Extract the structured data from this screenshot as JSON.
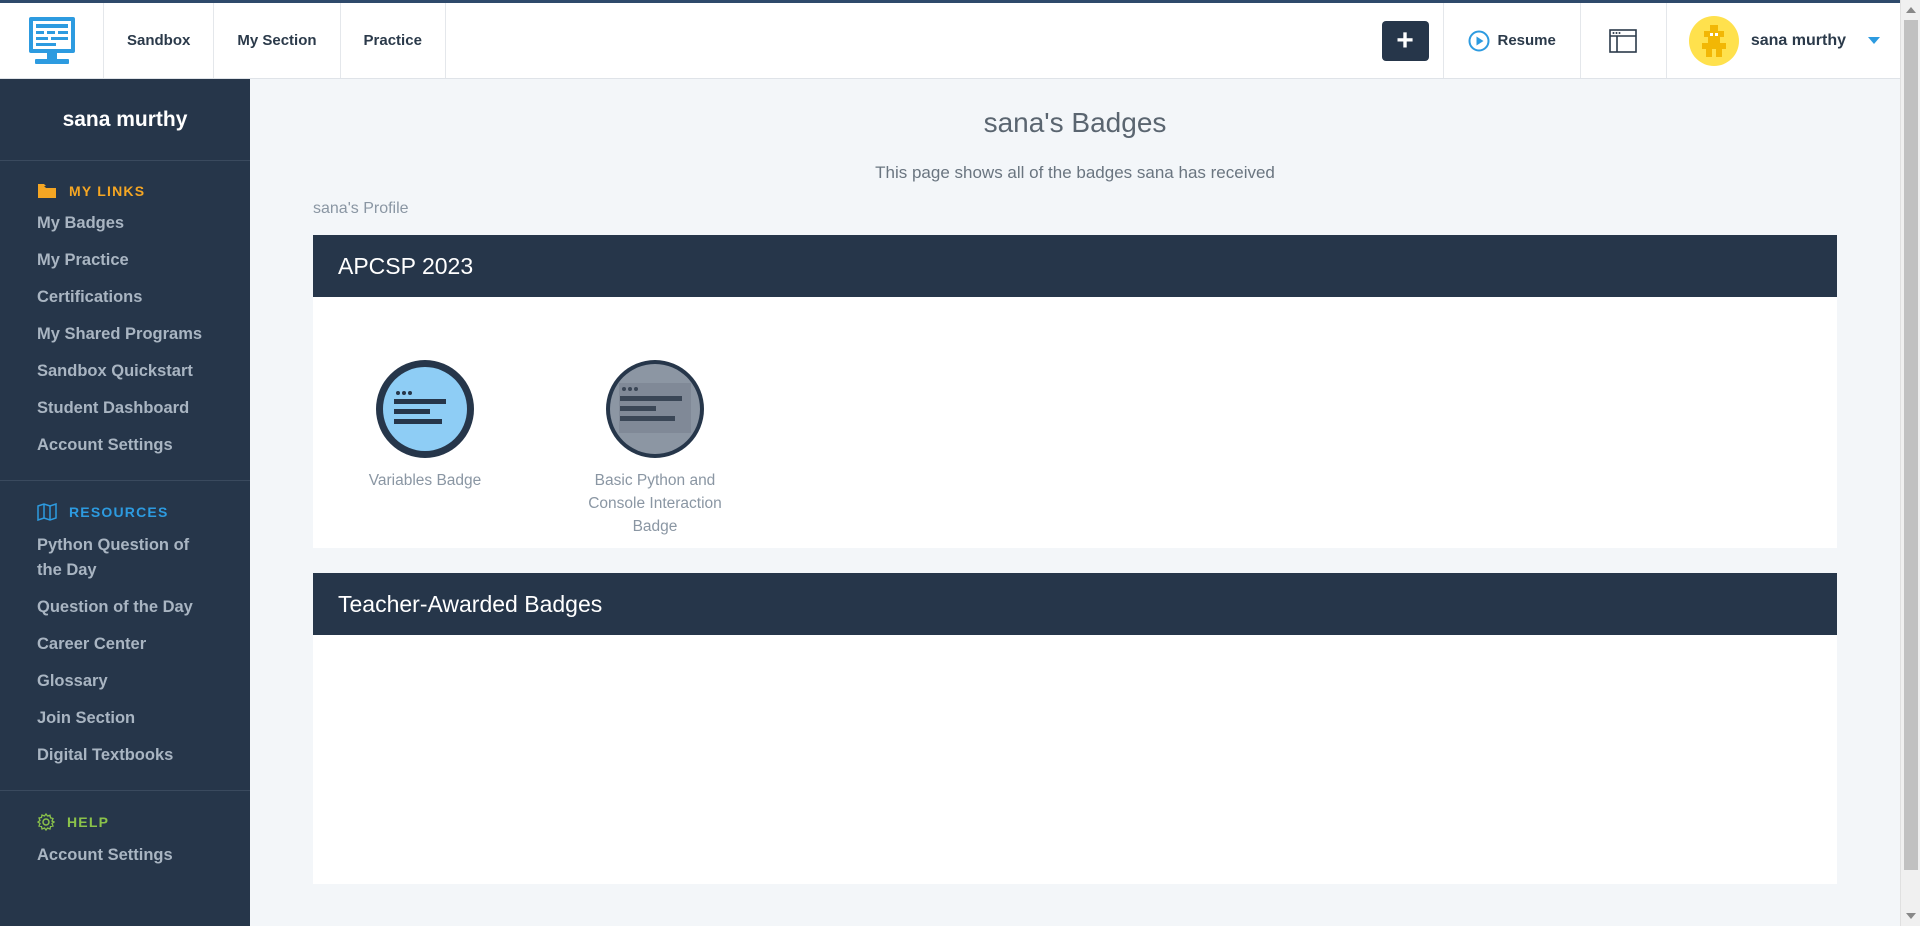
{
  "topbar": {
    "nav": [
      "Sandbox",
      "My Section",
      "Practice"
    ],
    "plus_label": "+",
    "resume_label": "Resume",
    "user_name": "sana murthy"
  },
  "sidebar": {
    "user_name": "sana murthy",
    "my_links": {
      "heading": "MY LINKS",
      "items": [
        "My Badges",
        "My Practice",
        "Certifications",
        "My Shared Programs",
        "Sandbox Quickstart",
        "Student Dashboard",
        "Account Settings"
      ]
    },
    "resources": {
      "heading": "RESOURCES",
      "items": [
        "Python Question of the Day",
        "Question of the Day",
        "Career Center",
        "Glossary",
        "Join Section",
        "Digital Textbooks"
      ]
    },
    "help": {
      "heading": "HELP",
      "items": [
        "Account Settings"
      ]
    }
  },
  "main": {
    "title": "sana's Badges",
    "subtitle": "This page shows all of the badges sana has received",
    "profile_link": "sana's Profile",
    "panels": [
      {
        "title": "APCSP 2023",
        "badges": [
          {
            "label": "Variables Badge",
            "earned": true
          },
          {
            "label": "Basic Python and Console Interaction Badge",
            "earned": false
          }
        ]
      },
      {
        "title": "Teacher-Awarded Badges",
        "badges": []
      }
    ]
  },
  "colors": {
    "navy": "#26364a",
    "links_orange": "#f5a623",
    "resources_blue": "#2d9be0",
    "help_green": "#8bc34a",
    "badge_blue": "#8ecdf5",
    "badge_gray": "#8c96a3"
  }
}
